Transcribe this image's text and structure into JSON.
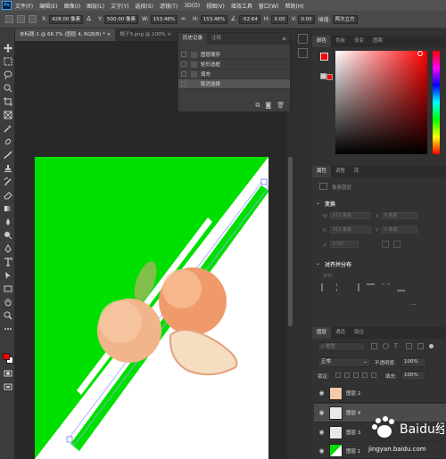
{
  "app": {
    "logo": "Ps"
  },
  "menu": [
    "文件(F)",
    "编辑(E)",
    "图像(I)",
    "图层(L)",
    "文字(Y)",
    "选择(S)",
    "滤镜(T)",
    "3D(D)",
    "视图(V)",
    "增效工具",
    "窗口(W)",
    "帮助(H)"
  ],
  "options": {
    "x_label": "X:",
    "x_value": "428.00 像素",
    "y_label": "Y:",
    "y_value": "500.00 像素",
    "w_label": "W:",
    "w_value": "153.46%",
    "h_label": "H:",
    "h_value": "153.46%",
    "angle_value": "-52.64",
    "skew_h_label": "H:",
    "skew_h_value": "0.00",
    "skew_v_label": "V:",
    "skew_v_value": "0.00",
    "interp_label": "插值:",
    "interp_value": "两次立方"
  },
  "tabs": [
    {
      "label": "未标题-1 @ 66.7% (图层 4, RGB/8) *",
      "active": true
    },
    {
      "label": "桃子3.png @ 100%",
      "active": false
    }
  ],
  "history": {
    "tabs": [
      "历史记录",
      "注释"
    ],
    "items": [
      "图层顺序",
      "矩形选框",
      "填充",
      "取消选择"
    ]
  },
  "color_panel": {
    "tabs": [
      "颜色",
      "色板",
      "渐变",
      "图案"
    ],
    "foreground": "#ff0000",
    "background": "#ffffff"
  },
  "properties": {
    "tabs": [
      "属性",
      "调整",
      "库"
    ],
    "layer_type": "像素图层",
    "transform_title": "变换",
    "w_label": "W",
    "w_value": "612 像素",
    "x_label": "X",
    "x_value": "0 像素",
    "h_label": "H",
    "h_value": "915 像素",
    "y_label": "Y",
    "y_value": "0 像素",
    "angle_value": "0.00°",
    "align_title": "对齐并分布",
    "align_sub": "对齐:"
  },
  "layers": {
    "tabs": [
      "图层",
      "通道",
      "路径"
    ],
    "search_placeholder": "类型",
    "blend_mode": "正常",
    "opacity_label": "不透明度:",
    "opacity_value": "100%",
    "lock_label": "锁定:",
    "fill_label": "填充:",
    "fill_value": "100%",
    "items": [
      {
        "name": "图层 2",
        "selected": false
      },
      {
        "name": "图层 4",
        "selected": true
      },
      {
        "name": "图层 3",
        "selected": false
      },
      {
        "name": "图层 1",
        "selected": false
      }
    ]
  },
  "colors": {
    "green": "#00e000",
    "red_swatch": "#ff0000",
    "accent_blue": "#31a8ff"
  },
  "watermark": {
    "brand": "Baidu经验",
    "url": "jingyan.baidu.com"
  }
}
